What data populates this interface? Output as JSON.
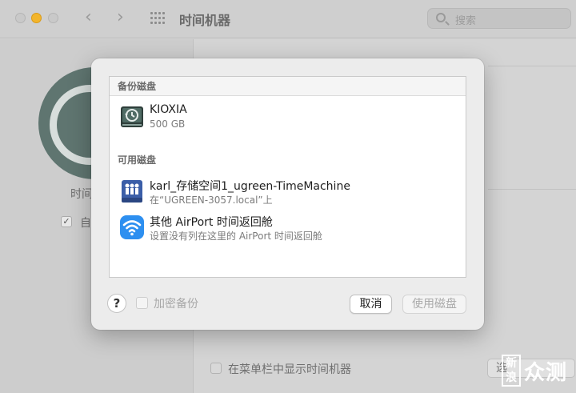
{
  "window": {
    "title": "时间机器",
    "search_placeholder": "搜索",
    "left_label": "时间",
    "left_checkbox_label": "自",
    "left_checkbox_checked": true,
    "menu_checkbox_label": "在菜单栏中显示时间机器",
    "menu_checkbox_checked": false,
    "options_button": "选",
    "watermark_box": "新浪",
    "watermark_text": "众测"
  },
  "sheet": {
    "backup_header": "备份磁盘",
    "backup_disks": [
      {
        "name": "KIOXIA",
        "detail": "500 GB",
        "icon": "time-machine-disk-icon"
      }
    ],
    "available_header": "可用磁盘",
    "available_disks": [
      {
        "name": "karl_存储空间1_ugreen-TimeMachine",
        "detail": "在“UGREEN-3057.local”上",
        "icon": "network-share-icon"
      },
      {
        "name": "其他 AirPort 时间返回舱",
        "detail": "设置没有列在这里的 AirPort 时间返回舱",
        "icon": "airport-wifi-icon"
      }
    ],
    "help": "?",
    "encrypt_label": "加密备份",
    "encrypt_checked": false,
    "cancel": "取消",
    "use_disk": "使用磁盘"
  }
}
